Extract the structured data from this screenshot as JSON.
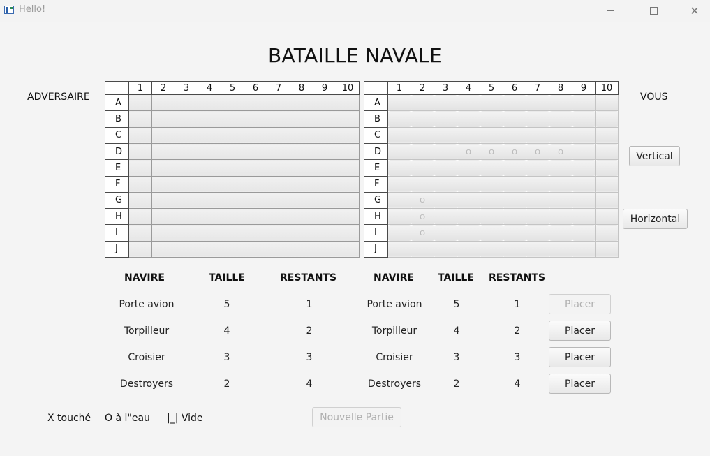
{
  "window": {
    "title": "Hello!"
  },
  "title": "BATAILLE NAVALE",
  "labels": {
    "adversaire": "ADVERSAIRE",
    "vous": "VOUS"
  },
  "columns": [
    "1",
    "2",
    "3",
    "4",
    "5",
    "6",
    "7",
    "8",
    "9",
    "10"
  ],
  "rows": [
    "A",
    "B",
    "C",
    "D",
    "E",
    "F",
    "G",
    "H",
    "I",
    "J"
  ],
  "player_marks": {
    "D": {
      "4": "O",
      "5": "O",
      "6": "O",
      "7": "O",
      "8": "O"
    },
    "G": {
      "2": "O"
    },
    "H": {
      "2": "O"
    },
    "I": {
      "2": "O"
    }
  },
  "orientation_buttons": {
    "vertical": "Vertical",
    "horizontal": "Horizontal"
  },
  "table_headers": {
    "navire": "NAVIRE",
    "taille": "TAILLE",
    "restants": "RESTANTS"
  },
  "ships": [
    {
      "name": "Porte avion",
      "size": "5",
      "remaining": "1"
    },
    {
      "name": "Torpilleur",
      "size": "4",
      "remaining": "2"
    },
    {
      "name": "Croisier",
      "size": "3",
      "remaining": "3"
    },
    {
      "name": "Destroyers",
      "size": "2",
      "remaining": "4"
    }
  ],
  "placer_label": "Placer",
  "nouvelle_partie": "Nouvelle Partie",
  "legend": {
    "hit": "X touché",
    "water": "O à l\"eau",
    "empty": "|_| Vide"
  }
}
